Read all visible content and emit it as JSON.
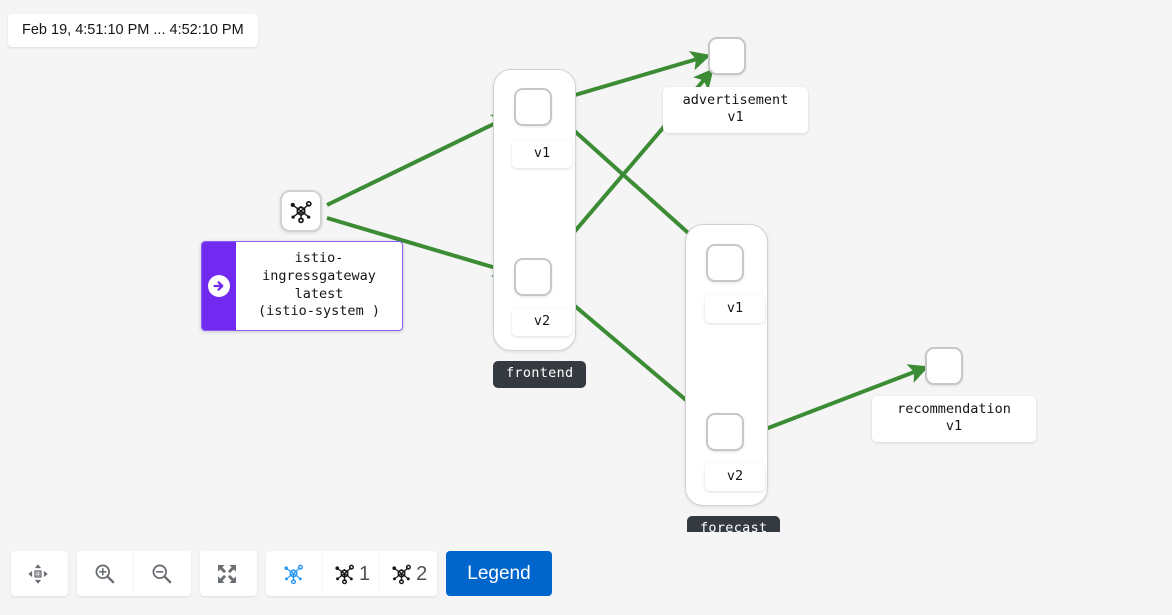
{
  "time_range": {
    "label": "Feb 19, 4:51:10 PM ... 4:52:10 PM"
  },
  "colors": {
    "edge": "#3c8c35",
    "edge_faded": "#a9cfa3",
    "group_badge_bg": "#343a40",
    "gateway_accent": "#7229f0",
    "legend_button": "#0066cc",
    "active_icon": "#2b9af3",
    "node_border": "#c7c7c7",
    "canvas_bg": "#f5f5f5"
  },
  "graph": {
    "gateway": {
      "name": "istio-ingressgateway",
      "version": "latest",
      "namespace": "(istio-system )",
      "label": "istio-ingressgateway\nlatest\n(istio-system )",
      "icon": "topology-icon",
      "badge_icon": "arrow-right-circle-icon"
    },
    "groups": [
      {
        "id": "frontend",
        "badge": "frontend",
        "nodes": [
          {
            "id": "frontend-v1",
            "label": "v1"
          },
          {
            "id": "frontend-v2",
            "label": "v2"
          }
        ]
      },
      {
        "id": "forecast",
        "badge": "forecast",
        "nodes": [
          {
            "id": "forecast-v1",
            "label": "v1"
          },
          {
            "id": "forecast-v2",
            "label": "v2"
          }
        ]
      }
    ],
    "standalone_nodes": [
      {
        "id": "advertisement",
        "name": "advertisement",
        "version": "v1",
        "label": "advertisement\nv1"
      },
      {
        "id": "recommendation",
        "name": "recommendation",
        "version": "v1",
        "label": "recommendation\nv1"
      }
    ],
    "edges": [
      {
        "from": "gateway",
        "to": "frontend-v1",
        "style": "solid"
      },
      {
        "from": "gateway",
        "to": "frontend-v2",
        "style": "solid"
      },
      {
        "from": "frontend-v1",
        "to": "advertisement",
        "style": "solid"
      },
      {
        "from": "frontend-v1",
        "to": "forecast-v1",
        "style": "solid"
      },
      {
        "from": "frontend-v2",
        "to": "advertisement",
        "style": "solid"
      },
      {
        "from": "frontend-v2",
        "to": "forecast-v2",
        "style": "solid"
      },
      {
        "from": "forecast-v2",
        "to": "recommendation",
        "style": "solid"
      }
    ]
  },
  "toolbar": {
    "pan_label": "",
    "zoom_in_label": "",
    "zoom_out_label": "",
    "fit_label": "",
    "graph_all_label": "",
    "graph_one_label": "1",
    "graph_two_label": "2",
    "legend_label": "Legend"
  }
}
